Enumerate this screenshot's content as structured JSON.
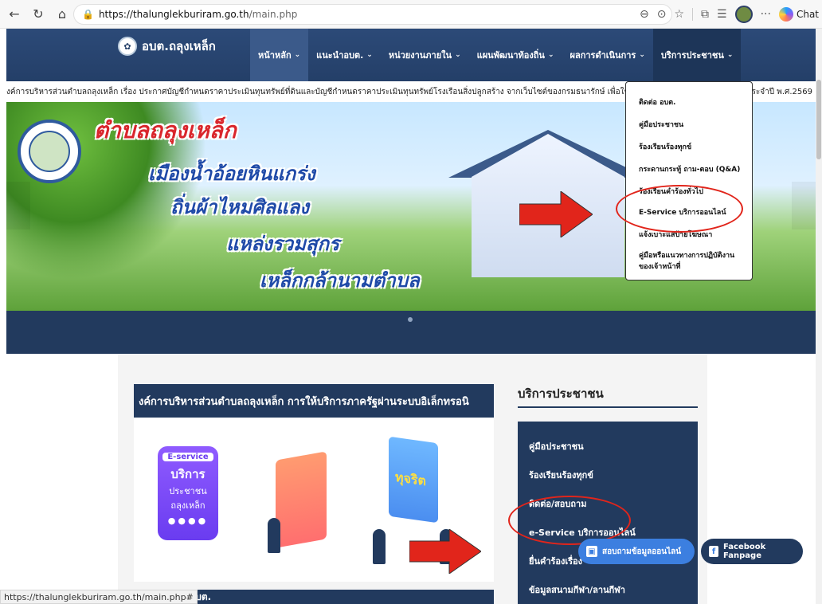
{
  "browser": {
    "url_host": "https://thalunglekburiram.go.th",
    "url_path": "/main.php",
    "chat_label": "Chat"
  },
  "site": {
    "logo_text": "อบต.ถลุงเหล็ก",
    "menu": [
      {
        "label": "หน้าหลัก"
      },
      {
        "label": "แนะนำอบต."
      },
      {
        "label": "หน่วยงานภายใน"
      },
      {
        "label": "แผนพัฒนาท้องถิ่น"
      },
      {
        "label": "ผลการดำเนินการ"
      },
      {
        "label": "บริการประชาชน"
      }
    ],
    "ticker_left": "งค์การบริหารส่วนตำบลถลุงเหล็ก เรื่อง ประกาศบัญชีกำหนดราคาประเมินทุนทรัพย์ที่ดินและบัญชีกำหนดราคาประเมินทุนทรัพย์โรงเรือนสิ่งปลูกสร้าง จากเว็บไซต์ของกรมธนารักษ์ เพื่อใช้สำ",
    "ticker_right": "ระจำปี พ.ศ.2569",
    "hero": {
      "title": "ตำบลถลุงเหล็ก",
      "line1": "เมืองน้ำอ้อยหินแกร่ง",
      "line2": "ถิ่นผ้าไหมศิลแลง",
      "line3": "แหล่งรวมสุกร",
      "line4": "เหล็กกล้านามตำบล"
    },
    "dropdown": [
      {
        "label": "ติดต่อ อบต."
      },
      {
        "label": "คู่มือประชาชน"
      },
      {
        "label": "ร้องเรียนร้องทุกข์"
      },
      {
        "label": "กระดานกระทู้ ถาม-ตอบ (Q&A)"
      },
      {
        "label": "ร้องเรียนคำร้องทั่วไป"
      },
      {
        "label": "E-Service บริการออนไลน์"
      },
      {
        "label": "แจ้งเบาะแสป้ายโฆษณา"
      },
      {
        "label": "คู่มือหรือแนวทางการปฏิบัติงาน",
        "label2": "ของเจ้าหน้าที่"
      }
    ],
    "card_title": "งค์การบริหารส่วนตำบลถลุงเหล็ก การให้บริการภาครัฐผ่านระบบอิเล็กทรอนิ",
    "card_graphics": {
      "eservice": "E-service",
      "service": "บริการ",
      "citizens": "ประชาชน",
      "town": "ถลุงเหล็ก",
      "corrupt": "ทุจริต"
    },
    "card2_title": "อบต.",
    "services_title": "บริการประชาชน",
    "services": [
      {
        "label": "คู่มือประชาชน"
      },
      {
        "label": "ร้องเรียนร้องทุกข์"
      },
      {
        "label": "ติดต่อ/สอบถาม"
      },
      {
        "label": "e-Service บริการออนไลน์"
      },
      {
        "label": "ยื่นคำร้องเรื่อง"
      },
      {
        "label": "ข้อมูลสนามกีฬา/ลานกีฬา"
      }
    ],
    "float_online": "สอบถามข้อมูลออนไลน์",
    "float_facebook": "Facebook Fanpage",
    "status_url": "https://thalunglekburiram.go.th/main.php#"
  },
  "colors": {
    "nav_bg": "#243f68",
    "accent_red": "#e1251b",
    "panel": "#223a5e"
  }
}
